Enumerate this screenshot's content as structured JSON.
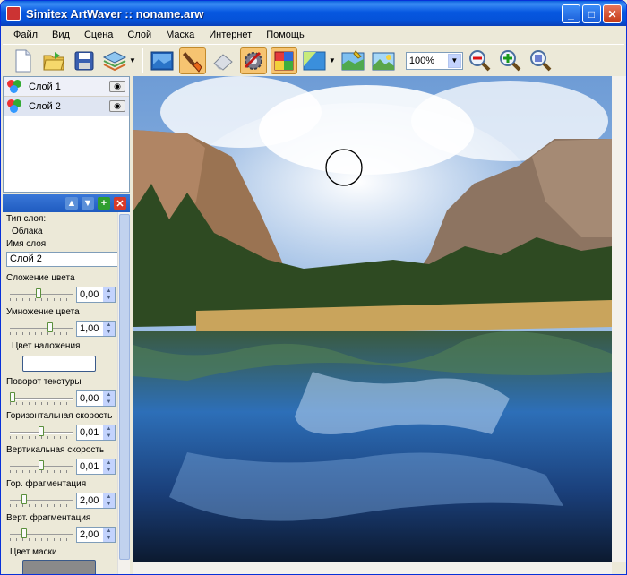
{
  "window": {
    "title": "Simitex ArtWaver :: noname.arw"
  },
  "menu": [
    "Файл",
    "Вид",
    "Сцена",
    "Слой",
    "Маска",
    "Интернет",
    "Помощь"
  ],
  "toolbar": {
    "zoom": "100%",
    "tools": [
      "new-file",
      "open-file",
      "save-file",
      "layers-dropdown",
      "image-layer",
      "brush-tool",
      "eraser-tool",
      "settings-tool",
      "color-tool",
      "gradient-tool",
      "paint-tool",
      "landscape-tool"
    ]
  },
  "layers": [
    {
      "name": "Слой 1"
    },
    {
      "name": "Слой 2"
    }
  ],
  "props": {
    "layer_type_label": "Тип слоя:",
    "layer_type_value": "Облака",
    "layer_name_label": "Имя слоя:",
    "layer_name_value": "Слой 2",
    "color_add_label": "Сложение цвета",
    "color_add_value": "0,00",
    "color_add_level": 0.45,
    "color_mult_label": "Умножение цвета",
    "color_mult_value": "1,00",
    "color_mult_level": 0.65,
    "overlay_color_label": "Цвет наложения",
    "overlay_color": "#ffffff",
    "texture_rot_label": "Поворот текстуры",
    "texture_rot_value": "0,00",
    "texture_rot_level": 0.0,
    "hspeed_label": "Горизонтальная скорость",
    "hspeed_value": "0,01",
    "hspeed_level": 0.5,
    "vspeed_label": "Вертикальная скорость",
    "vspeed_value": "0,01",
    "vspeed_level": 0.5,
    "hfrag_label": "Гор. фрагментация",
    "hfrag_value": "2,00",
    "hfrag_level": 0.2,
    "vfrag_label": "Верт. фрагментация",
    "vfrag_value": "2,00",
    "vfrag_level": 0.2,
    "mask_color_label": "Цвет маски",
    "mask_color": "#8a8a8a"
  }
}
